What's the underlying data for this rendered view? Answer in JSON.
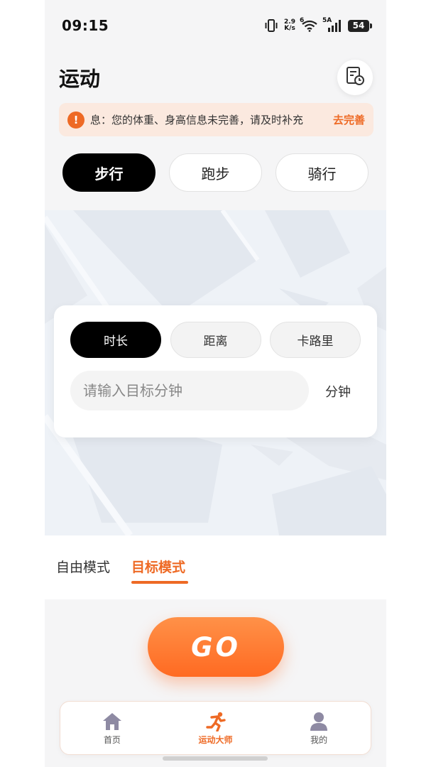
{
  "status_bar": {
    "time": "09:15",
    "net_speed_value": "2.9",
    "net_speed_unit": "K/s",
    "wifi_label": "6",
    "signal_label": "5A",
    "battery": "54"
  },
  "header": {
    "title": "运动",
    "history_icon": "history-record-icon"
  },
  "notice": {
    "text": "息：您的体重、身高信息未完善，请及时补充",
    "action": "去完善"
  },
  "sport_tabs": [
    {
      "label": "步行",
      "active": true
    },
    {
      "label": "跑步",
      "active": false
    },
    {
      "label": "骑行",
      "active": false
    }
  ],
  "goal": {
    "tabs": [
      {
        "label": "时长",
        "active": true
      },
      {
        "label": "距离",
        "active": false
      },
      {
        "label": "卡路里",
        "active": false
      }
    ],
    "input_placeholder": "请输入目标分钟",
    "unit": "分钟"
  },
  "modes": {
    "free": "自由模式",
    "target": "目标模式",
    "active": "target"
  },
  "go_button": "GO",
  "bottom_nav": [
    {
      "label": "首页",
      "icon": "home-icon",
      "active": false
    },
    {
      "label": "运动大师",
      "icon": "running-icon",
      "active": true
    },
    {
      "label": "我的",
      "icon": "user-icon",
      "active": false
    }
  ],
  "colors": {
    "accent": "#ee6a25",
    "go_gradient_top": "#ff9148",
    "go_gradient_bottom": "#ff6a22",
    "map_bg": "#eef2f7"
  }
}
